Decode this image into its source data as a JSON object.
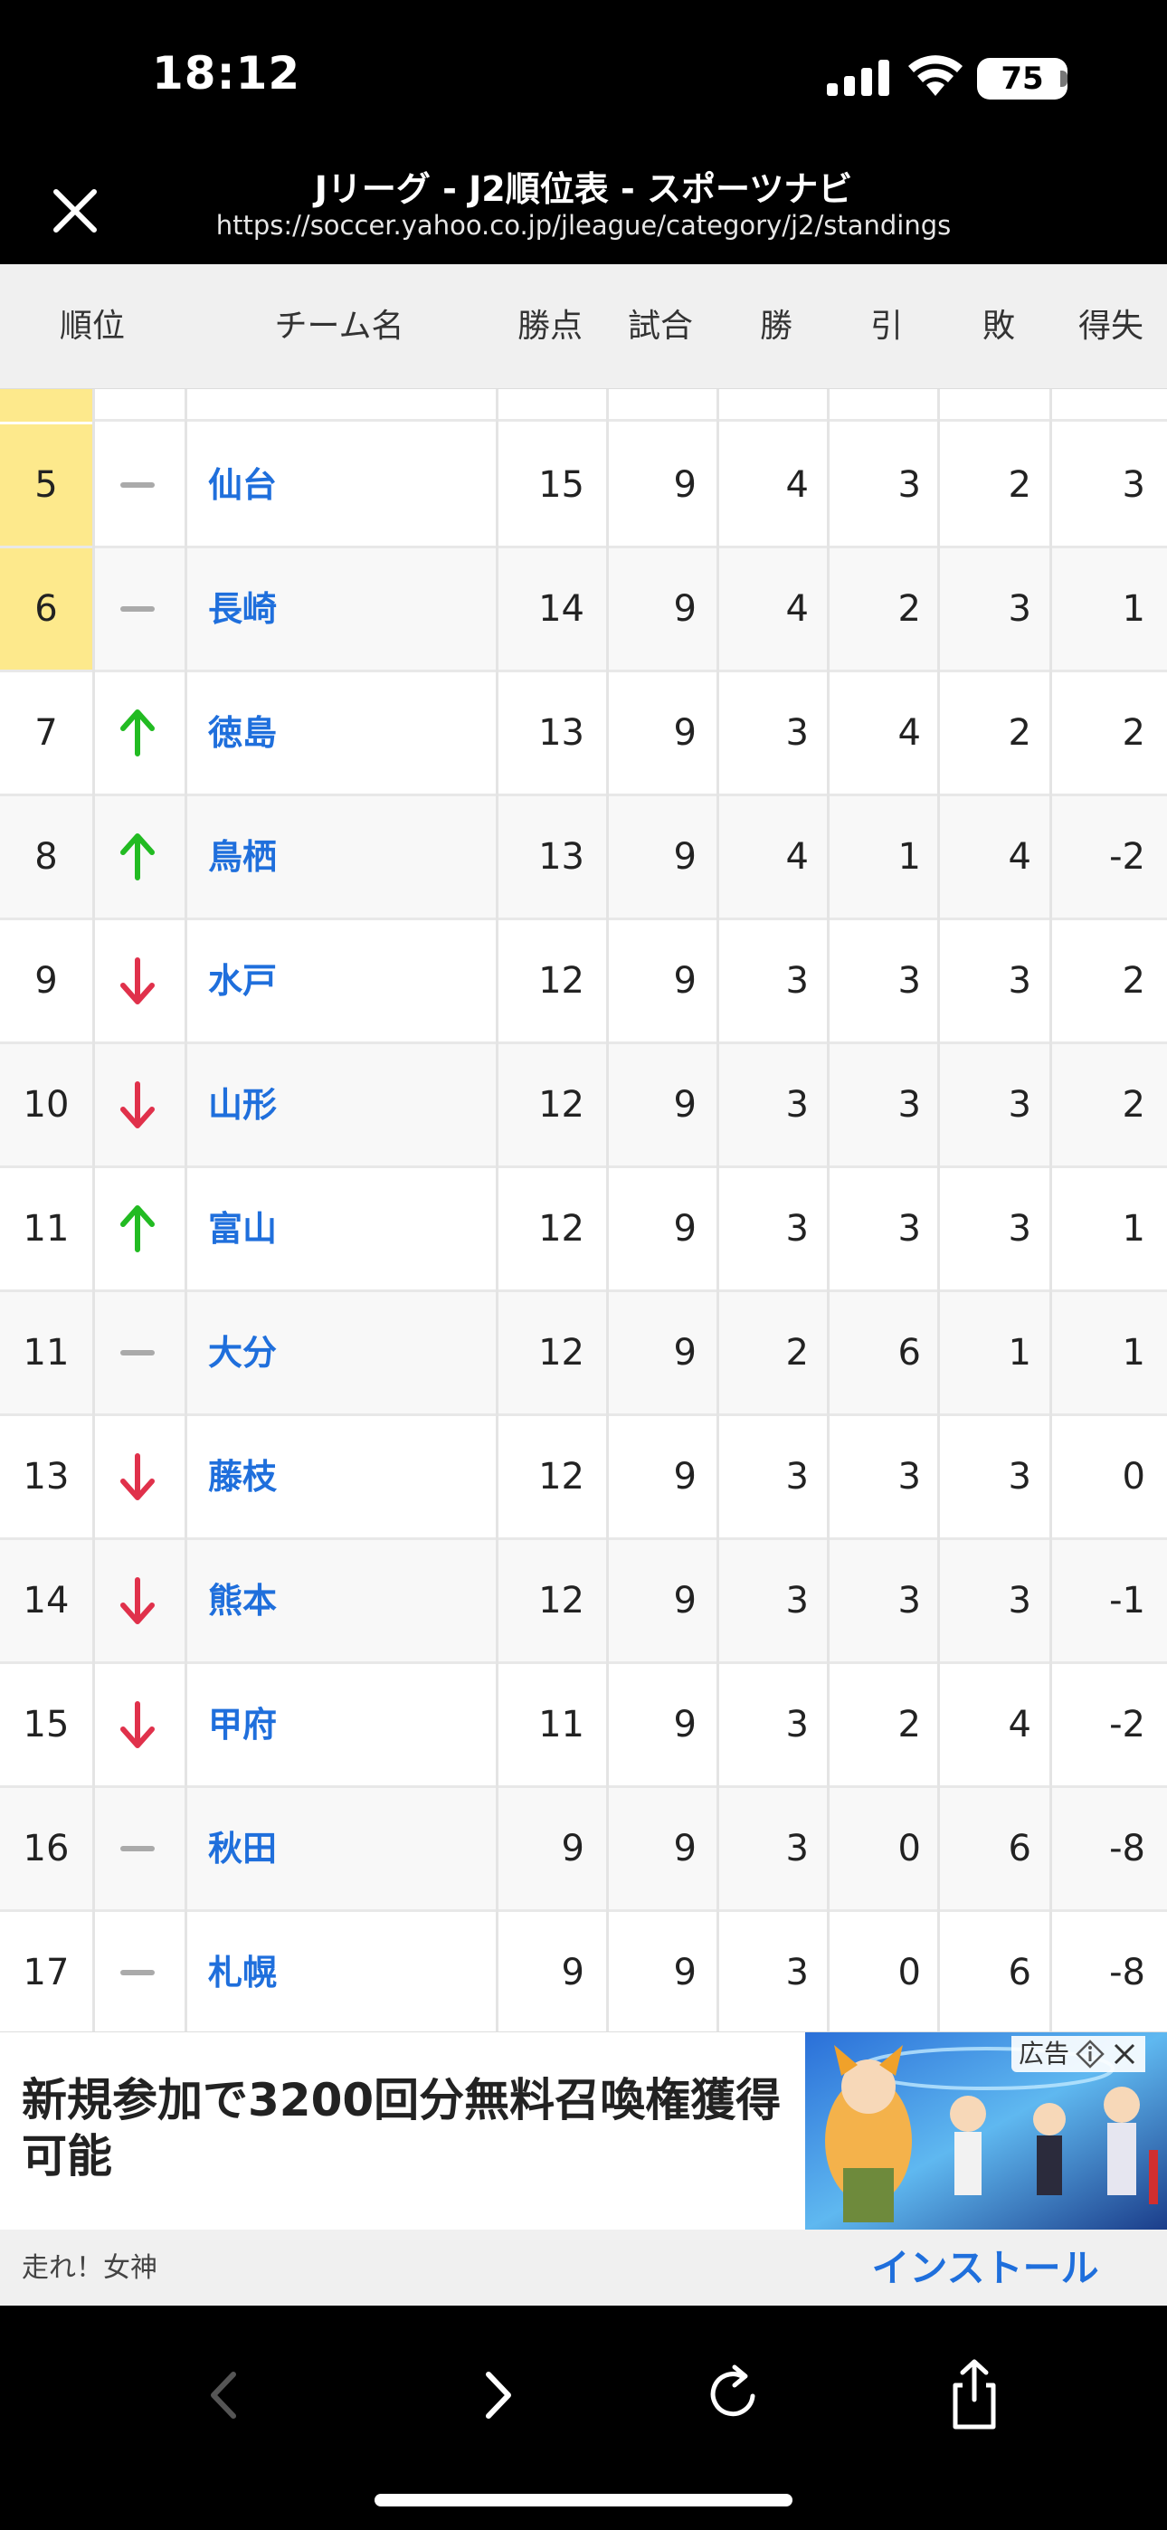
{
  "status_bar": {
    "time": "18:12",
    "battery": "75"
  },
  "header": {
    "title": "Jリーグ - J2順位表 - スポーツナビ",
    "url": "https://soccer.yahoo.co.jp/jleague/category/j2/standings"
  },
  "table": {
    "columns": [
      "順位",
      "チーム名",
      "勝点",
      "試合",
      "勝",
      "引",
      "敗",
      "得失"
    ],
    "rows": [
      {
        "rank": "5",
        "trend": "same",
        "team": "仙台",
        "pts": "15",
        "gp": "9",
        "w": "4",
        "d": "3",
        "l": "2",
        "gd": "3",
        "highlight": true
      },
      {
        "rank": "6",
        "trend": "same",
        "team": "長崎",
        "pts": "14",
        "gp": "9",
        "w": "4",
        "d": "2",
        "l": "3",
        "gd": "1",
        "highlight": true
      },
      {
        "rank": "7",
        "trend": "up",
        "team": "徳島",
        "pts": "13",
        "gp": "9",
        "w": "3",
        "d": "4",
        "l": "2",
        "gd": "2",
        "highlight": false
      },
      {
        "rank": "8",
        "trend": "up",
        "team": "鳥栖",
        "pts": "13",
        "gp": "9",
        "w": "4",
        "d": "1",
        "l": "4",
        "gd": "-2",
        "highlight": false
      },
      {
        "rank": "9",
        "trend": "down",
        "team": "水戸",
        "pts": "12",
        "gp": "9",
        "w": "3",
        "d": "3",
        "l": "3",
        "gd": "2",
        "highlight": false
      },
      {
        "rank": "10",
        "trend": "down",
        "team": "山形",
        "pts": "12",
        "gp": "9",
        "w": "3",
        "d": "3",
        "l": "3",
        "gd": "2",
        "highlight": false
      },
      {
        "rank": "11",
        "trend": "up",
        "team": "富山",
        "pts": "12",
        "gp": "9",
        "w": "3",
        "d": "3",
        "l": "3",
        "gd": "1",
        "highlight": false
      },
      {
        "rank": "11",
        "trend": "same",
        "team": "大分",
        "pts": "12",
        "gp": "9",
        "w": "2",
        "d": "6",
        "l": "1",
        "gd": "1",
        "highlight": false
      },
      {
        "rank": "13",
        "trend": "down",
        "team": "藤枝",
        "pts": "12",
        "gp": "9",
        "w": "3",
        "d": "3",
        "l": "3",
        "gd": "0",
        "highlight": false
      },
      {
        "rank": "14",
        "trend": "down",
        "team": "熊本",
        "pts": "12",
        "gp": "9",
        "w": "3",
        "d": "3",
        "l": "3",
        "gd": "-1",
        "highlight": false
      },
      {
        "rank": "15",
        "trend": "down",
        "team": "甲府",
        "pts": "11",
        "gp": "9",
        "w": "3",
        "d": "2",
        "l": "4",
        "gd": "-2",
        "highlight": false
      },
      {
        "rank": "16",
        "trend": "same",
        "team": "秋田",
        "pts": "9",
        "gp": "9",
        "w": "3",
        "d": "0",
        "l": "6",
        "gd": "-8",
        "highlight": false
      },
      {
        "rank": "17",
        "trend": "same",
        "team": "札幌",
        "pts": "9",
        "gp": "9",
        "w": "3",
        "d": "0",
        "l": "6",
        "gd": "-8",
        "highlight": false
      }
    ]
  },
  "ad": {
    "copy": "新規参加で3200回分無料召喚権獲得可能",
    "brand": "走れ！女神",
    "install_label": "インストール",
    "tag_label": "広告"
  },
  "toolbar": {
    "icons": [
      "back-icon",
      "forward-icon",
      "reload-icon",
      "share-icon"
    ]
  },
  "colors": {
    "accent": "#1f6fdc",
    "up": "#22bb22",
    "down": "#e0314b",
    "same": "#aaaaaa",
    "highlight": "#fde98c"
  }
}
